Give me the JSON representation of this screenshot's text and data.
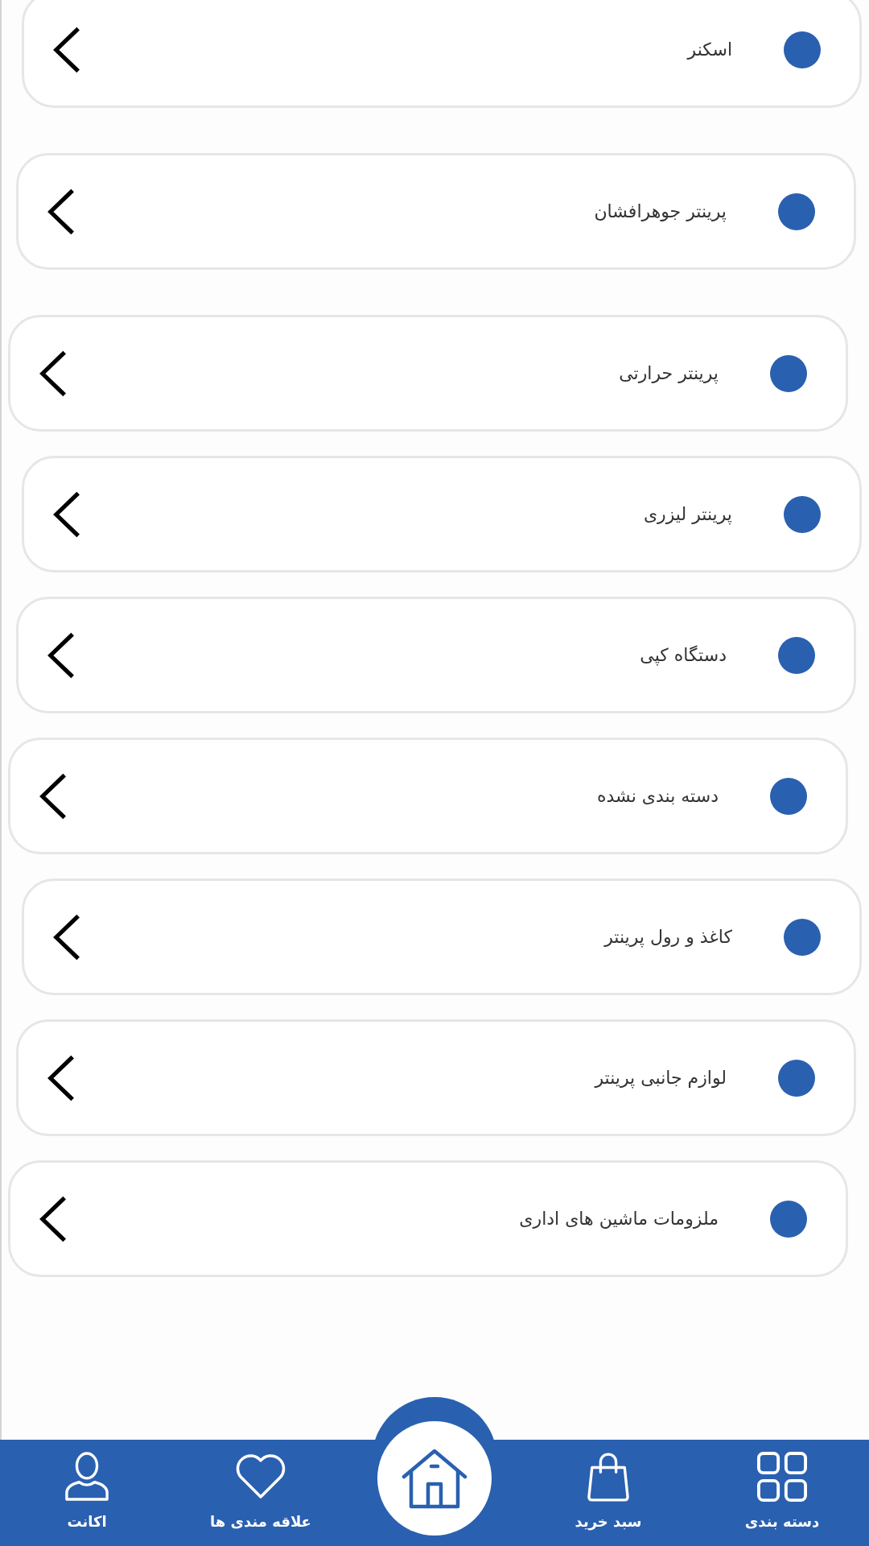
{
  "categories": [
    {
      "label": "اسکنر"
    },
    {
      "label": "پرینتر جوهرافشان"
    },
    {
      "label": "پرینتر حرارتی"
    },
    {
      "label": "پرینتر لیزری"
    },
    {
      "label": "دستگاه کپی"
    },
    {
      "label": "دسته بندی نشده"
    },
    {
      "label": "کاغذ و رول پرینتر"
    },
    {
      "label": "لوازم جانبی پرینتر"
    },
    {
      "label": "ملزومات ماشین های اداری"
    }
  ],
  "bottom_nav": [
    {
      "kind": "tab",
      "label": "دسته بندی"
    },
    {
      "kind": "tab",
      "label": "سبد خرید"
    },
    {
      "kind": "home"
    },
    {
      "kind": "tab",
      "label": "علاقه مندی ها"
    },
    {
      "kind": "tab",
      "label": "اکانت"
    }
  ]
}
